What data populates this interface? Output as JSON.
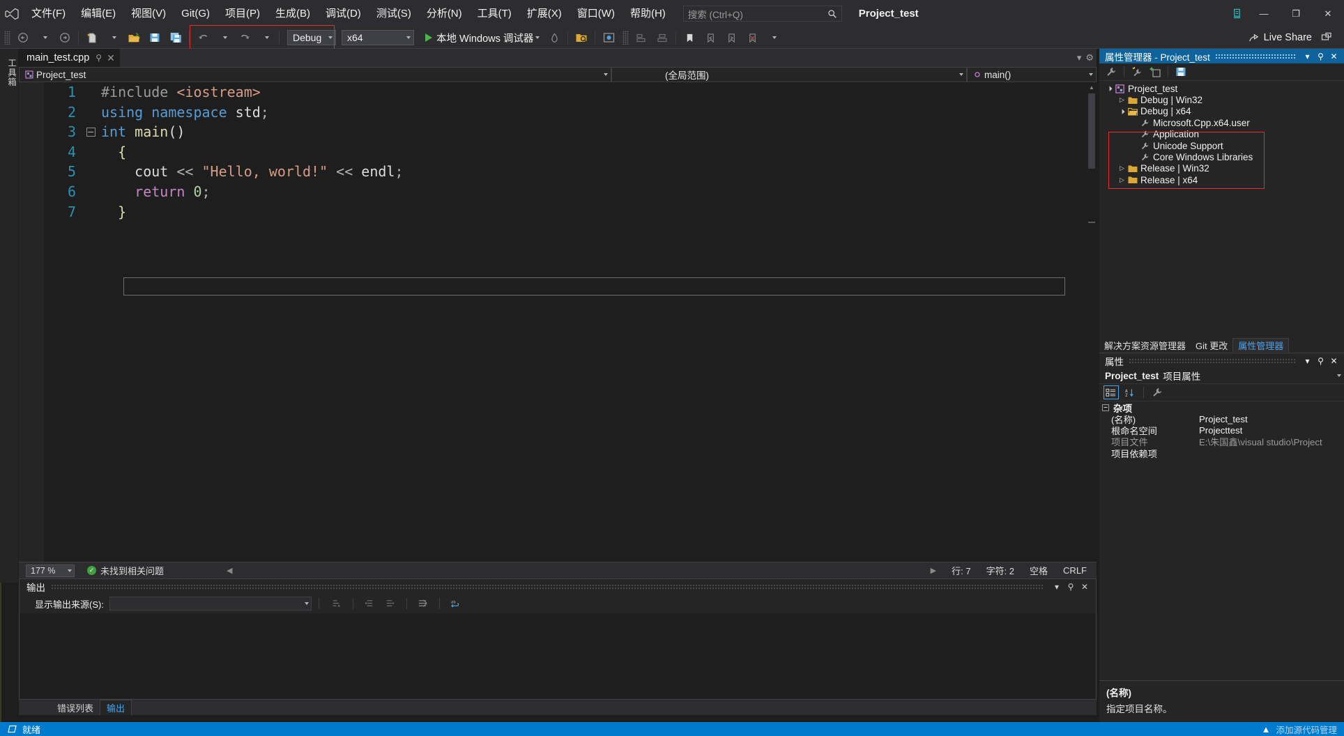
{
  "app": {
    "solution_name": "Project_test",
    "logo_icon": "visual-studio-logo"
  },
  "menu": {
    "items": [
      {
        "label": "文件(F)"
      },
      {
        "label": "编辑(E)"
      },
      {
        "label": "视图(V)"
      },
      {
        "label": "Git(G)"
      },
      {
        "label": "项目(P)"
      },
      {
        "label": "生成(B)"
      },
      {
        "label": "调试(D)"
      },
      {
        "label": "测试(S)"
      },
      {
        "label": "分析(N)"
      },
      {
        "label": "工具(T)"
      },
      {
        "label": "扩展(X)"
      },
      {
        "label": "窗口(W)"
      },
      {
        "label": "帮助(H)"
      }
    ]
  },
  "search": {
    "placeholder": "搜索 (Ctrl+Q)",
    "icon": "search-icon"
  },
  "window_controls": {
    "feedback_icon": "feedback-icon",
    "minimize": "—",
    "maximize": "❐",
    "close": "✕"
  },
  "toolbar": {
    "navigate_back_icon": "arrow-back-icon",
    "navigate_forward_icon": "arrow-forward-icon",
    "new_item_icon": "new-item-icon",
    "open_file_icon": "open-folder-icon",
    "save_icon": "save-icon",
    "save_all_icon": "save-all-icon",
    "undo_icon": "undo-icon",
    "redo_icon": "redo-icon",
    "config_value": "Debug",
    "platform_value": "x64",
    "run_label": "本地 Windows 调试器",
    "hot_reload_icon": "hot-reload-icon",
    "solution_explorer_icon": "solution-explorer-icon",
    "preview_icon": "preview-selected-icon",
    "live_share_label": "Live Share",
    "live_share_icon": "live-share-icon",
    "notify_icon": "notification-icon"
  },
  "left_rail": {
    "toolbox_label": "工具箱"
  },
  "editor": {
    "tab_label": "main_test.cpp",
    "pin_icon": "pin-icon",
    "close_icon": "close-icon",
    "nav_project": "Project_test",
    "nav_scope": "(全局范围)",
    "nav_member": "main()",
    "project_icon": "cpp-project-icon",
    "member_icon": "method-icon",
    "code_lines": [
      {
        "num": "1",
        "fold": "none",
        "guide": "none",
        "tokens": [
          {
            "t": "#include ",
            "c": "k-pre"
          },
          {
            "t": "<iostream>",
            "c": "k-hdr"
          }
        ]
      },
      {
        "num": "2",
        "fold": "none",
        "guide": "none",
        "tokens": [
          {
            "t": "using ",
            "c": "k-kw"
          },
          {
            "t": "namespace ",
            "c": "k-kw"
          },
          {
            "t": "std",
            "c": "k-plain"
          },
          {
            "t": ";",
            "c": "k-op"
          }
        ]
      },
      {
        "num": "3",
        "fold": "minus",
        "guide": "none",
        "tokens": [
          {
            "t": "int ",
            "c": "k-type"
          },
          {
            "t": "main",
            "c": "k-fn"
          },
          {
            "t": "()",
            "c": "k-plain"
          }
        ]
      },
      {
        "num": "4",
        "fold": "none",
        "guide": "solid",
        "tokens": [
          {
            "t": "  {",
            "c": "k-brace"
          }
        ]
      },
      {
        "num": "5",
        "fold": "none",
        "guide": "dash",
        "tokens": [
          {
            "t": "    cout ",
            "c": "k-plain"
          },
          {
            "t": "<< ",
            "c": "k-op"
          },
          {
            "t": "\"Hello, world!\"",
            "c": "k-str"
          },
          {
            "t": " << ",
            "c": "k-op"
          },
          {
            "t": "endl",
            "c": "k-plain"
          },
          {
            "t": ";",
            "c": "k-op"
          }
        ]
      },
      {
        "num": "6",
        "fold": "none",
        "guide": "dash",
        "tokens": [
          {
            "t": "    return ",
            "c": "k-ret"
          },
          {
            "t": "0",
            "c": "k-num"
          },
          {
            "t": ";",
            "c": "k-op"
          }
        ]
      },
      {
        "num": "7",
        "fold": "none",
        "guide": "solid",
        "tokens": [
          {
            "t": "  }",
            "c": "k-brace"
          }
        ]
      }
    ]
  },
  "editor_status": {
    "zoom": "177 %",
    "problems": "未找到相关问题",
    "line": "行: 7",
    "column": "字符: 2",
    "spaces": "空格",
    "eol": "CRLF",
    "ok_icon": "check-circle-icon"
  },
  "output_panel": {
    "title": "输出",
    "source_label": "显示输出来源(S):",
    "source_value": "",
    "dropdown_icon": "chevron-down-icon",
    "tool_icons": [
      "go-to-message-icon",
      "previous-message-icon",
      "next-message-icon",
      "clear-all-icon",
      "toggle-word-wrap-icon"
    ],
    "ctl_dropdown": "▾",
    "ctl_pin": "⚲",
    "ctl_close": "✕",
    "tabs": [
      {
        "label": "错误列表",
        "active": false
      },
      {
        "label": "输出",
        "active": true
      }
    ]
  },
  "property_manager": {
    "title": "属性管理器 - Project_test",
    "ctl_dropdown": "▾",
    "ctl_pin": "⚲",
    "ctl_close": "✕",
    "toolbar_icons": [
      "wrench-icon",
      "add-property-sheet-icon",
      "add-new-project-property-sheet-icon",
      "save-icon"
    ],
    "tree": [
      {
        "indent": 0,
        "twisty": "expanded",
        "icon": "cpp-project-icon",
        "label": "Project_test"
      },
      {
        "indent": 1,
        "twisty": "collapsed",
        "icon": "folder-icon",
        "label": "Debug | Win32"
      },
      {
        "indent": 1,
        "twisty": "expanded",
        "icon": "folder-open-icon",
        "label": "Debug | x64"
      },
      {
        "indent": 2,
        "twisty": "none",
        "icon": "wrench-icon",
        "label": "Microsoft.Cpp.x64.user"
      },
      {
        "indent": 2,
        "twisty": "none",
        "icon": "wrench-icon",
        "label": "Application"
      },
      {
        "indent": 2,
        "twisty": "none",
        "icon": "wrench-icon",
        "label": "Unicode Support"
      },
      {
        "indent": 2,
        "twisty": "none",
        "icon": "wrench-icon",
        "label": "Core Windows Libraries"
      },
      {
        "indent": 1,
        "twisty": "collapsed",
        "icon": "folder-icon",
        "label": "Release | Win32"
      },
      {
        "indent": 1,
        "twisty": "collapsed",
        "icon": "folder-icon",
        "label": "Release | x64"
      }
    ]
  },
  "dock_tabs": [
    {
      "label": "解决方案资源管理器",
      "active": false
    },
    {
      "label": "Git 更改",
      "active": false
    },
    {
      "label": "属性管理器",
      "active": true
    }
  ],
  "properties": {
    "title": "属性",
    "ctl_dropdown": "▾",
    "ctl_pin": "⚲",
    "ctl_close": "✕",
    "object_name": "Project_test",
    "object_kind": "项目属性",
    "toolbar_icons": [
      "categorized-icon",
      "alphabetical-icon",
      "property-pages-icon"
    ],
    "category": "杂项",
    "rows": [
      {
        "name": "(名称)",
        "value": "Project_test",
        "dim": false
      },
      {
        "name": "根命名空间",
        "value": "Projecttest",
        "dim": false
      },
      {
        "name": "项目文件",
        "value": "E:\\朱国鑫\\visual studio\\Project",
        "dim": true
      },
      {
        "name": "项目依赖项",
        "value": "",
        "dim": false
      }
    ],
    "desc_title": "(名称)",
    "desc_body": "指定项目名称。"
  },
  "status_bar": {
    "ready": "就绪",
    "ready_icon": "ready-icon",
    "up_icon": "▲",
    "watermark": "添加源代码管理"
  },
  "colors": {
    "accent_blue": "#007acc",
    "panel_header_blue": "#0e639c",
    "chrome_bg": "#2d2d30",
    "editor_bg": "#1e1e1e",
    "dock_bg": "#252526",
    "highlight_red": "#e03030",
    "line_number": "#2b91af",
    "link_blue": "#4aa3e8"
  }
}
